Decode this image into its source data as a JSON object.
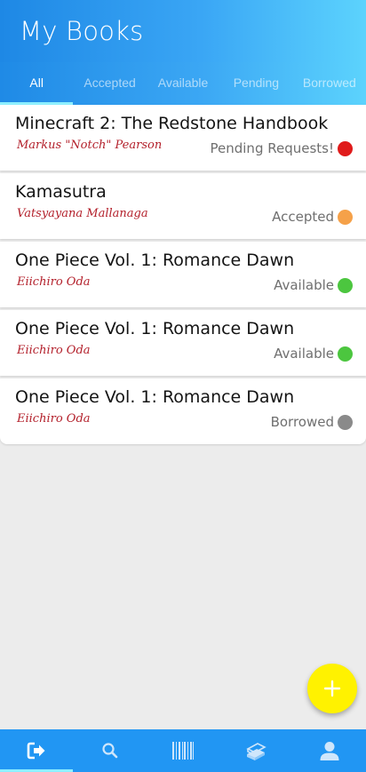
{
  "app": {
    "title": "My Books"
  },
  "tabs": [
    {
      "label": "All",
      "active": true
    },
    {
      "label": "Accepted",
      "active": false
    },
    {
      "label": "Available",
      "active": false
    },
    {
      "label": "Pending",
      "active": false
    },
    {
      "label": "Borrowed",
      "active": false
    }
  ],
  "books": [
    {
      "title": "Minecraft 2: The Redstone Handbook",
      "author": "Markus \"Notch\" Pearson",
      "status": "Pending Requests!",
      "status_color": "#e01b1b"
    },
    {
      "title": "Kamasutra",
      "author": "Vatsyayana Mallanaga",
      "status": "Accepted",
      "status_color": "#f5a149"
    },
    {
      "title": "One Piece Vol. 1: Romance Dawn",
      "author": "Eiichiro Oda",
      "status": "Available",
      "status_color": "#4cc63f"
    },
    {
      "title": "One Piece Vol. 1: Romance Dawn",
      "author": "Eiichiro Oda",
      "status": "Available",
      "status_color": "#4cc63f"
    },
    {
      "title": "One Piece Vol. 1: Romance Dawn",
      "author": "Eiichiro Oda",
      "status": "Borrowed",
      "status_color": "#8a8a8a"
    }
  ],
  "fab": {
    "icon": "plus-icon",
    "color": "#fff200"
  },
  "bottom_nav": [
    {
      "icon": "logout-icon",
      "active": true
    },
    {
      "icon": "search-icon",
      "active": false
    },
    {
      "icon": "barcode-icon",
      "active": false
    },
    {
      "icon": "books-icon",
      "active": false
    },
    {
      "icon": "profile-icon",
      "active": false
    }
  ],
  "colors": {
    "primary": "#2196f3",
    "accent": "#8ef0ff"
  }
}
